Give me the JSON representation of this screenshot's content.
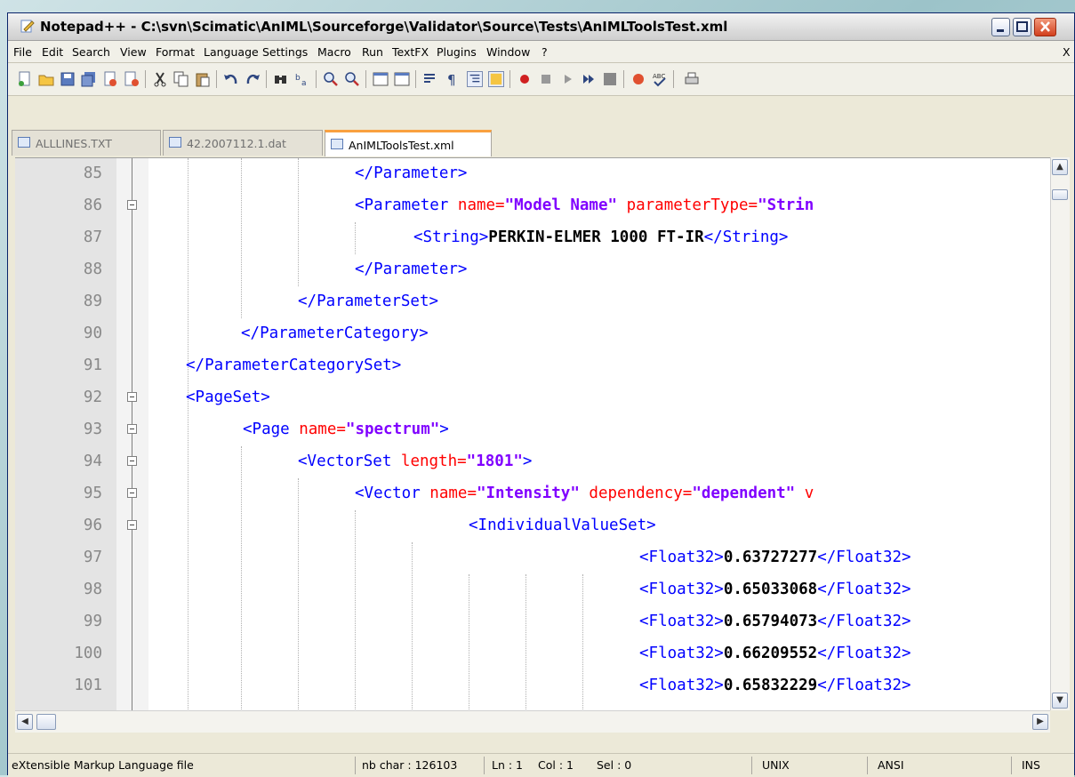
{
  "window": {
    "title": "Notepad++ - C:\\svn\\Scimatic\\AnIML\\Sourceforge\\Validator\\Source\\Tests\\AnIMLToolsTest.xml"
  },
  "menu": {
    "items": [
      "File",
      "Edit",
      "Search",
      "View",
      "Format",
      "Language",
      "Settings",
      "Macro",
      "Run",
      "TextFX",
      "Plugins",
      "Window",
      "?"
    ],
    "close_label": "X"
  },
  "tabs": [
    {
      "label": "ALLLINES.TXT",
      "active": false
    },
    {
      "label": "42.2007112.1.dat",
      "active": false
    },
    {
      "label": "AnIMLToolsTest.xml",
      "active": true
    }
  ],
  "editor": {
    "lines": [
      {
        "num": "85"
      },
      {
        "num": "86"
      },
      {
        "num": "87"
      },
      {
        "num": "88"
      },
      {
        "num": "89"
      },
      {
        "num": "90"
      },
      {
        "num": "91"
      },
      {
        "num": "92"
      },
      {
        "num": "93"
      },
      {
        "num": "94"
      },
      {
        "num": "95"
      },
      {
        "num": "96"
      },
      {
        "num": "97"
      },
      {
        "num": "98"
      },
      {
        "num": "99"
      },
      {
        "num": "100"
      },
      {
        "num": "101"
      }
    ],
    "code": {
      "l85_tag": "</Parameter>",
      "l86_tag": "<Parameter ",
      "l86_attr1": "name=",
      "l86_val1": "\"Model Name\"",
      "l86_attr2": " parameterType=",
      "l86_val2": "\"Strin",
      "l87_open": "<String>",
      "l87_text": "PERKIN-ELMER 1000 FT-IR",
      "l87_close": "</String>",
      "l88_tag": "</Parameter>",
      "l89_tag": "</ParameterSet>",
      "l90_tag": "</ParameterCategory>",
      "l91_tag": "</ParameterCategorySet>",
      "l92_tag": "<PageSet>",
      "l93_tag": "<Page ",
      "l93_attr": "name=",
      "l93_val": "\"spectrum\"",
      "l93_end": ">",
      "l94_tag": "<VectorSet ",
      "l94_attr": "length=",
      "l94_val": "\"1801\"",
      "l94_end": ">",
      "l95_tag": "<Vector ",
      "l95_attr1": "name=",
      "l95_val1": "\"Intensity\"",
      "l95_attr2": " dependency=",
      "l95_val2": "\"dependent\"",
      "l95_attr3": " v",
      "l96_tag": "<IndividualValueSet>",
      "float_open": "<Float32>",
      "float_close": "</Float32>",
      "v97": "0.63727277",
      "v98": "0.65033068",
      "v99": "0.65794073",
      "v100": "0.66209552",
      "v101": "0.65832229"
    }
  },
  "status": {
    "file_type": "eXtensible Markup Language file",
    "nb_char": "nb char : 126103",
    "ln": "Ln : 1",
    "col": "Col : 1",
    "sel": "Sel : 0",
    "eol": "UNIX",
    "encoding": "ANSI",
    "mode": "INS"
  }
}
